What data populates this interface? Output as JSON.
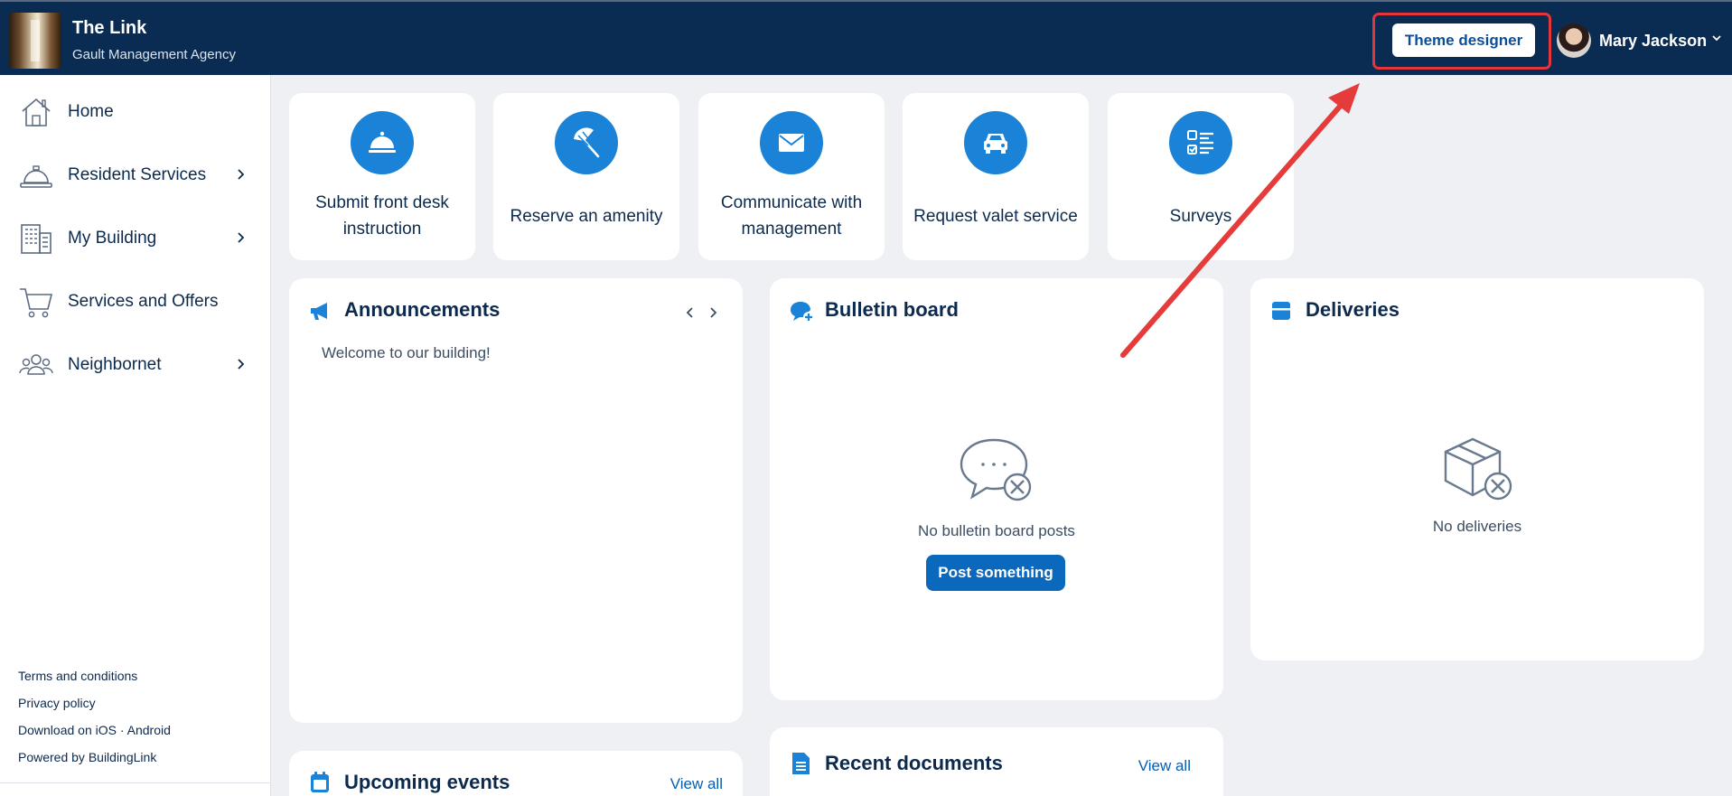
{
  "header": {
    "title": "The Link",
    "subtitle": "Gault Management Agency",
    "theme_designer_label": "Theme designer",
    "user_name": "Mary Jackson"
  },
  "sidebar": {
    "items": [
      {
        "label": "Home",
        "icon": "house-icon",
        "has_submenu": false
      },
      {
        "label": "Resident Services",
        "icon": "service-bell-icon",
        "has_submenu": true
      },
      {
        "label": "My Building",
        "icon": "building-icon",
        "has_submenu": true
      },
      {
        "label": "Services and Offers",
        "icon": "shopping-cart-icon",
        "has_submenu": false
      },
      {
        "label": "Neighbornet",
        "icon": "people-icon",
        "has_submenu": true
      }
    ],
    "footer_links": [
      "Terms and conditions",
      "Privacy policy",
      "Download on iOS · Android",
      "Powered by BuildingLink"
    ]
  },
  "quick_actions": [
    {
      "label": "Submit front desk instruction",
      "icon": "bell-cloche-icon"
    },
    {
      "label": "Reserve an amenity",
      "icon": "umbrella-icon"
    },
    {
      "label": "Communicate with management",
      "icon": "envelope-icon"
    },
    {
      "label": "Request valet service",
      "icon": "car-icon"
    },
    {
      "label": "Surveys",
      "icon": "checklist-icon"
    }
  ],
  "announcements": {
    "title": "Announcements",
    "message": "Welcome to our building!"
  },
  "bulletin": {
    "title": "Bulletin board",
    "empty_text": "No bulletin board posts",
    "post_button": "Post something"
  },
  "deliveries": {
    "title": "Deliveries",
    "empty_text": "No deliveries"
  },
  "events": {
    "title": "Upcoming events",
    "view_all": "View all"
  },
  "documents": {
    "title": "Recent documents",
    "view_all": "View all"
  },
  "colors": {
    "header_bg": "#0a2c52",
    "accent": "#1a83d8",
    "highlight": "#e2363b",
    "page_bg": "#eef0f4"
  }
}
